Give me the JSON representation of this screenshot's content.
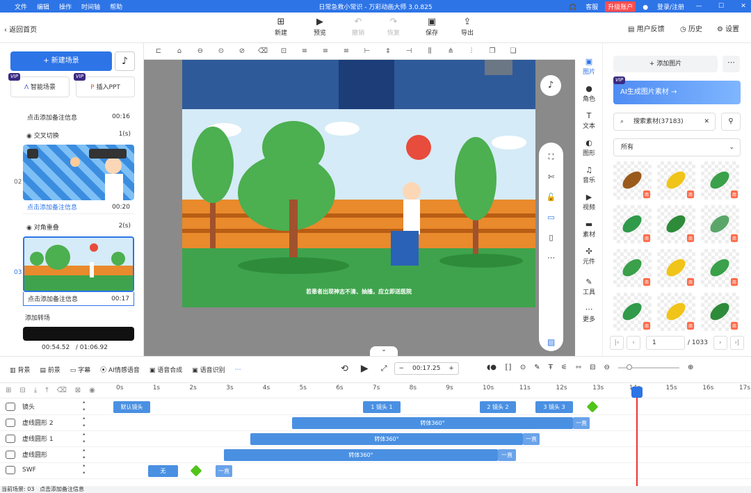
{
  "app": {
    "title": "日常急救小常识 - 万彩动画大师 3.0.825",
    "brand": "#2d74e7"
  },
  "menu": [
    "文件",
    "编辑",
    "操作",
    "时间轴",
    "帮助"
  ],
  "topright": {
    "service": "客服",
    "upgrade": "升级账户",
    "login": "登录/注册"
  },
  "toolbar": {
    "back": "返回首页",
    "buttons": [
      {
        "label": "新建",
        "icon": "plus-icon"
      },
      {
        "label": "预览",
        "icon": "play-icon"
      },
      {
        "label": "撤销",
        "icon": "undo-icon"
      },
      {
        "label": "恢复",
        "icon": "redo-icon"
      },
      {
        "label": "保存",
        "icon": "save-icon"
      },
      {
        "label": "导出",
        "icon": "export-icon"
      }
    ],
    "feedback": "用户反馈",
    "history": "历史",
    "settings": "设置"
  },
  "left": {
    "new_scene": "新建场景",
    "smart_scene": "智能场景",
    "insert_ppt": "插入PPT",
    "vip": "VIP",
    "scenes": [
      {
        "note": "点击添加备注信息",
        "time": "00:16"
      },
      {
        "num": "02",
        "note": "点击添加备注信息",
        "time": "00:20",
        "transition": "交叉切换",
        "tdur": "1(s)"
      },
      {
        "num": "03",
        "note": "点击添加备注信息",
        "time": "00:17",
        "transition": "对角重叠",
        "tdur": "2(s)"
      }
    ],
    "add_transition": "添加转场",
    "time_current": "00:54.52",
    "time_total": "/ 01:06.92"
  },
  "canvas": {
    "subtitle": "若患者出现神志不清、抽搐，应立即送医院"
  },
  "rightnav": [
    {
      "label": "图片",
      "icon": "image-icon"
    },
    {
      "label": "角色",
      "icon": "person-icon"
    },
    {
      "label": "文本",
      "icon": "text-icon"
    },
    {
      "label": "图形",
      "icon": "shape-icon"
    },
    {
      "label": "音乐",
      "icon": "music-icon"
    },
    {
      "label": "视频",
      "icon": "video-icon"
    },
    {
      "label": "素材",
      "icon": "folder-icon"
    },
    {
      "label": "元件",
      "icon": "component-icon"
    },
    {
      "label": "工具",
      "icon": "tool-icon"
    },
    {
      "label": "更多",
      "icon": "more-icon"
    }
  ],
  "assets": {
    "add_image": "添加图片",
    "ai_banner": "AI生成图片素材 →",
    "search_placeholder": "搜索素材(37183)",
    "category": "所有",
    "badge": "商",
    "page": "1",
    "total_pages": "/ 1033"
  },
  "timeline_tools": {
    "bg": "背景",
    "fg": "前景",
    "caption": "字幕",
    "ai_voice": "AI情感语音",
    "tts": "语音合成",
    "asr": "语音识别",
    "time": "00:17.25"
  },
  "timeline": {
    "ticks": [
      "0s",
      "1s",
      "2s",
      "3s",
      "4s",
      "5s",
      "6s",
      "7s",
      "8s",
      "9s",
      "10s",
      "11s",
      "12s",
      "13s",
      "14s",
      "15s",
      "16s",
      "17s"
    ],
    "tracks": [
      {
        "name": "镜头",
        "bars": [
          {
            "label": "默认镜头"
          },
          {
            "label": "1 镜头 1"
          },
          {
            "label": "2 镜头 2"
          },
          {
            "label": "3 镜头 3"
          }
        ]
      },
      {
        "name": "虚线圆形 2",
        "bars": [
          {
            "label": "转体360°"
          },
          {
            "label": "一直"
          }
        ]
      },
      {
        "name": "虚线圆形 1",
        "bars": [
          {
            "label": "转体360°"
          },
          {
            "label": "一直"
          }
        ]
      },
      {
        "name": "虚线圆形",
        "bars": [
          {
            "label": "转体360°"
          },
          {
            "label": "一直"
          }
        ]
      },
      {
        "name": "SWF",
        "bars": [
          {
            "label": "无"
          },
          {
            "label": "一直"
          }
        ]
      }
    ]
  },
  "status": {
    "current_scene": "当前场景: 03",
    "note": "点击添加备注信息"
  }
}
